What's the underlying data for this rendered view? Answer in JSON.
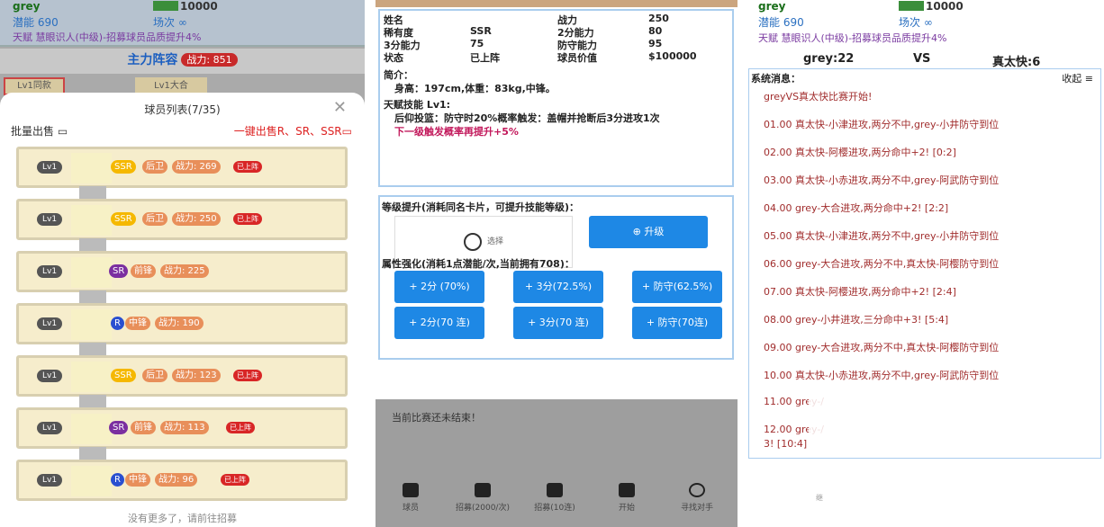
{
  "left": {
    "user": "grey",
    "money": "10000",
    "potential_label": "潜能 690",
    "games_label": "场次 ∞",
    "talent": "天赋 慧眼识人(中级)-招募球员品质提升4%",
    "lineup_title": "主力阵容",
    "lineup_power": "战力: 851",
    "bg_buttons": [
      "Lv1同款",
      "Lv1大合"
    ],
    "sheet_title": "球员列表(7/35)",
    "bulk_sell": "批量出售",
    "one_key_sell": "一键出售R、SR、SSR",
    "cards": [
      {
        "lv": "Lv1",
        "rarity": "SSR",
        "pos": "后卫",
        "power": "战力: 269",
        "on": "已上阵",
        "rc": "#f5b800",
        "pc": "#e88f5a",
        "wc": "#e88f5a"
      },
      {
        "lv": "Lv1",
        "rarity": "SSR",
        "pos": "后卫",
        "power": "战力: 250",
        "on": "已上阵",
        "rc": "#f5b800",
        "pc": "#e88f5a",
        "wc": "#e88f5a"
      },
      {
        "lv": "Lv1",
        "rarity": "SR",
        "pos": "前锋",
        "power": "战力: 225",
        "on": "",
        "rc": "#7b2fa0",
        "pc": "#e88f5a",
        "wc": "#e88f5a"
      },
      {
        "lv": "Lv1",
        "rarity": "R",
        "pos": "中锋",
        "power": "战力: 190",
        "on": "",
        "rc": "#2a4fd0",
        "pc": "#e88f5a",
        "wc": "#e88f5a"
      },
      {
        "lv": "Lv1",
        "rarity": "SSR",
        "pos": "后卫",
        "power": "战力: 123",
        "on": "已上阵",
        "rc": "#f5b800",
        "pc": "#e88f5a",
        "wc": "#e88f5a"
      },
      {
        "lv": "Lv1",
        "rarity": "SR",
        "pos": "前锋",
        "power": "战力: 113",
        "on": "已上阵",
        "rc": "#7b2fa0",
        "pc": "#e88f5a",
        "wc": "#e88f5a"
      },
      {
        "lv": "Lv1",
        "rarity": "R",
        "pos": "中锋",
        "power": "战力: 96",
        "on": "已上阵",
        "rc": "#2a4fd0",
        "pc": "#e88f5a",
        "wc": "#e88f5a"
      }
    ],
    "no_more": "没有更多了，请前往招募"
  },
  "mid": {
    "rows": [
      {
        "k": "姓名",
        "v": "",
        "k2": "战力",
        "v2": "250"
      },
      {
        "k": "稀有度",
        "v": "SSR",
        "k2": "2分能力",
        "v2": "80"
      },
      {
        "k": "3分能力",
        "v": "75",
        "k2": "防守能力",
        "v2": "95"
      },
      {
        "k": "状态",
        "v": "已上阵",
        "k2": "球员价值",
        "v2": "$100000"
      }
    ],
    "intro_title": "简介：",
    "intro_body": "身高：197cm,体重：83kg,中锋。",
    "talent_title": "天赋技能 Lv1:",
    "talent_body": "后仰投篮：防守时20%概率触发：盖帽并抢断后3分进攻1次",
    "talent_next": "下一级触发概率再提升+5%",
    "upgrade_title": "等级提升(消耗同名卡片，可提升技能等级)：",
    "select_label": "选择",
    "upgrade_btn": "升级",
    "enhance_title": "属性强化(消耗1点潜能/次,当前拥有708)：",
    "enhance_buttons": [
      "+ 2分 (70%)",
      "+ 3分(72.5%)",
      "+ 防守(62.5%)",
      "+ 2分(70 连)",
      "+ 3分(70 连)",
      "+ 防守(70连)"
    ],
    "match_msg": "当前比赛还未结束！",
    "tabs": [
      "球员",
      "招募(2000/次)",
      "招募(10连)",
      "开始",
      "寻找对手"
    ]
  },
  "right": {
    "user": "grey",
    "money": "10000",
    "potential_label": "潜能 690",
    "games_label": "场次 ∞",
    "talent": "天赋 慧眼识人(中级)-招募球员品质提升4%",
    "home": "grey:22",
    "vs": "VS",
    "away": "真太快:6",
    "sys_label": "系统消息：",
    "collapse": "收起 ≡",
    "logs": [
      "greyVS真太快比赛开始!",
      "01.00 真太快-小津进攻,两分不中,grey-小井防守到位",
      "02.00 真太快-阿樱进攻,两分命中+2! [0:2]",
      "03.00 真太快-小赤进攻,两分不中,grey-阿武防守到位",
      "04.00 grey-大合进攻,两分命中+2! [2:2]",
      "05.00 真太快-小津进攻,两分不中,grey-小井防守到位",
      "06.00 grey-大合进攻,两分不中,真太快-阿樱防守到位",
      "07.00 真太快-阿樱进攻,两分命中+2! [2:4]",
      "08.00 grey-小井进攻,三分命中+3! [5:4]",
      "09.00 grey-大合进攻,两分不中,真太快-阿樱防守到位",
      "10.00 真太快-小赤进攻,两分不中,grey-阿武防守到位",
      "11.00 grey-/",
      "12.00 grey-/",
      "3! [10:4]"
    ],
    "footer": "继"
  }
}
